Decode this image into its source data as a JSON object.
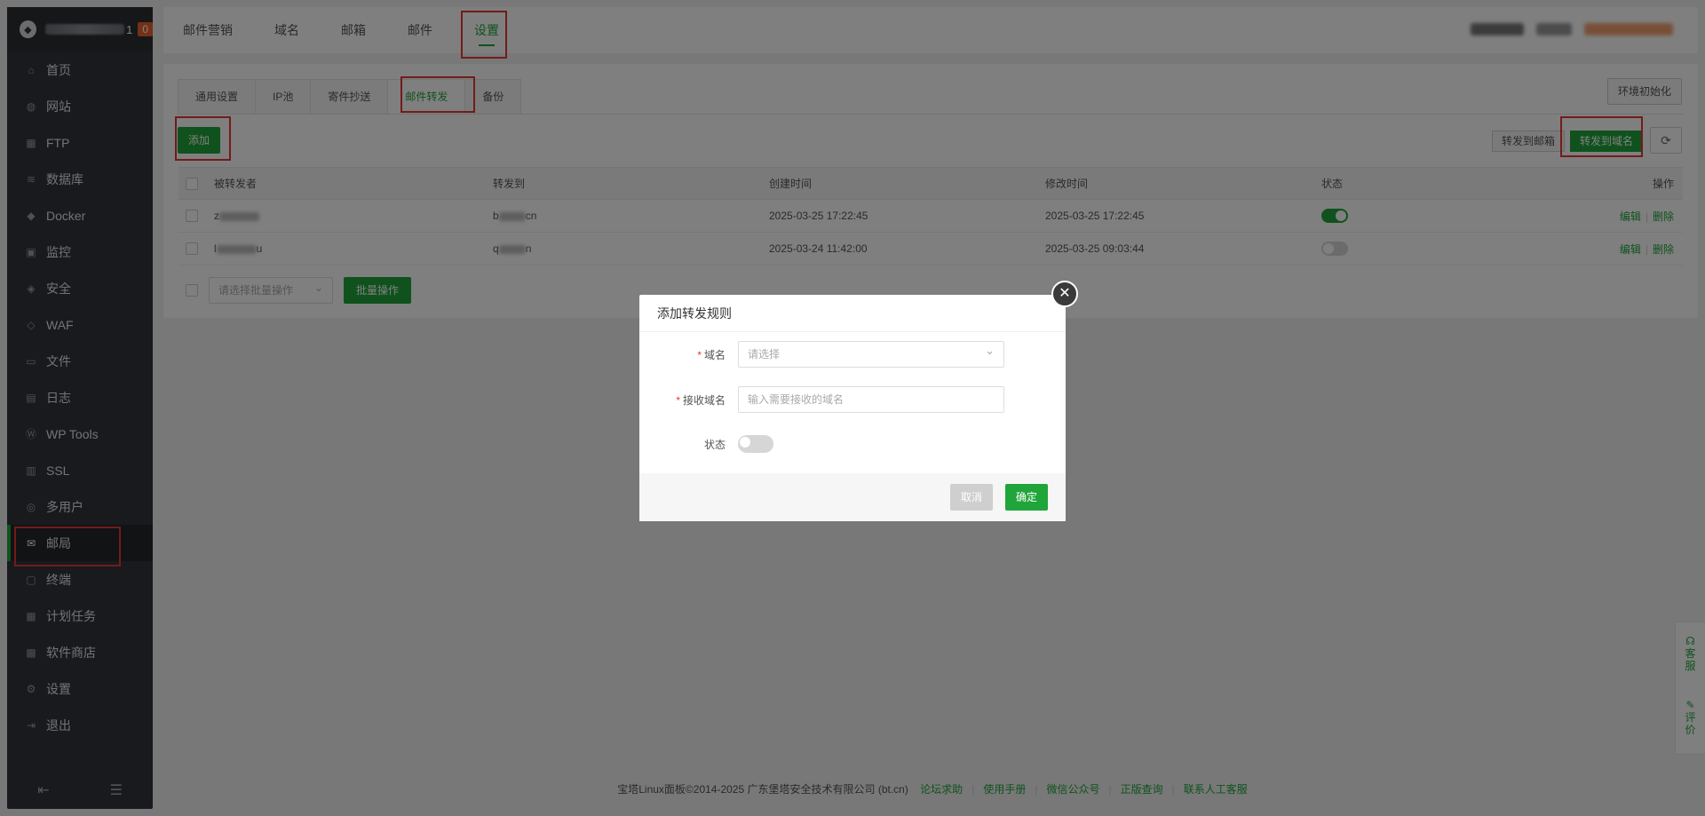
{
  "sidebar": {
    "badge": "0",
    "server_suffix": "1",
    "items": [
      {
        "label": "首页",
        "icon": "home-icon"
      },
      {
        "label": "网站",
        "icon": "globe-icon"
      },
      {
        "label": "FTP",
        "icon": "ftp-icon"
      },
      {
        "label": "数据库",
        "icon": "database-icon"
      },
      {
        "label": "Docker",
        "icon": "docker-icon"
      },
      {
        "label": "监控",
        "icon": "monitor-icon"
      },
      {
        "label": "安全",
        "icon": "shield-icon"
      },
      {
        "label": "WAF",
        "icon": "waf-icon"
      },
      {
        "label": "文件",
        "icon": "folder-icon"
      },
      {
        "label": "日志",
        "icon": "log-icon"
      },
      {
        "label": "WP Tools",
        "icon": "wordpress-icon"
      },
      {
        "label": "SSL",
        "icon": "ssl-icon"
      },
      {
        "label": "多用户",
        "icon": "users-icon"
      },
      {
        "label": "邮局",
        "icon": "mail-icon"
      },
      {
        "label": "终端",
        "icon": "terminal-icon"
      },
      {
        "label": "计划任务",
        "icon": "calendar-icon"
      },
      {
        "label": "软件商店",
        "icon": "apps-icon"
      },
      {
        "label": "设置",
        "icon": "gear-icon"
      },
      {
        "label": "退出",
        "icon": "logout-icon"
      }
    ],
    "active_index": 13
  },
  "topnav": {
    "items": [
      "邮件营销",
      "域名",
      "邮箱",
      "邮件",
      "设置"
    ],
    "active_index": 4
  },
  "panel": {
    "tabs": [
      "通用设置",
      "IP池",
      "寄件抄送",
      "邮件转发",
      "备份"
    ],
    "active_tab": 3,
    "env_button": "环境初始化",
    "add_button": "添加",
    "forward_mailbox_button": "转发到邮箱",
    "forward_domain_button": "转发到域名",
    "table": {
      "headers": [
        "被转发者",
        "转发到",
        "创建时间",
        "修改时间",
        "状态",
        "操作"
      ],
      "rows": [
        {
          "from_prefix": "z",
          "to_prefix": "b",
          "to_suffix": "cn",
          "created": "2025-03-25 17:22:45",
          "modified": "2025-03-25 17:22:45",
          "status": true
        },
        {
          "from_prefix": "l",
          "from_suffix": "u",
          "to_prefix": "q",
          "to_suffix": "n",
          "created": "2025-03-24 11:42:00",
          "modified": "2025-03-25 09:03:44",
          "status": false
        }
      ],
      "edit_label": "编辑",
      "delete_label": "删除"
    },
    "batch_placeholder": "请选择批量操作",
    "batch_button": "批量操作"
  },
  "modal": {
    "title": "添加转发规则",
    "domain_label": "域名",
    "domain_placeholder": "请选择",
    "receive_label": "接收域名",
    "receive_placeholder": "输入需要接收的域名",
    "status_label": "状态",
    "status_on": false,
    "cancel": "取消",
    "confirm": "确定"
  },
  "footer": {
    "copyright": "宝塔Linux面板©2014-2025 广东堡塔安全技术有限公司 (bt.cn)",
    "links": [
      "论坛求助",
      "使用手册",
      "微信公众号",
      "正版查询",
      "联系人工客服"
    ]
  },
  "float": {
    "service": "客服",
    "review": "评价"
  },
  "colors": {
    "accent": "#20a53a",
    "sidebar_bg": "#30343a",
    "badge": "#e8622c",
    "highlight_box": "#e53935"
  }
}
